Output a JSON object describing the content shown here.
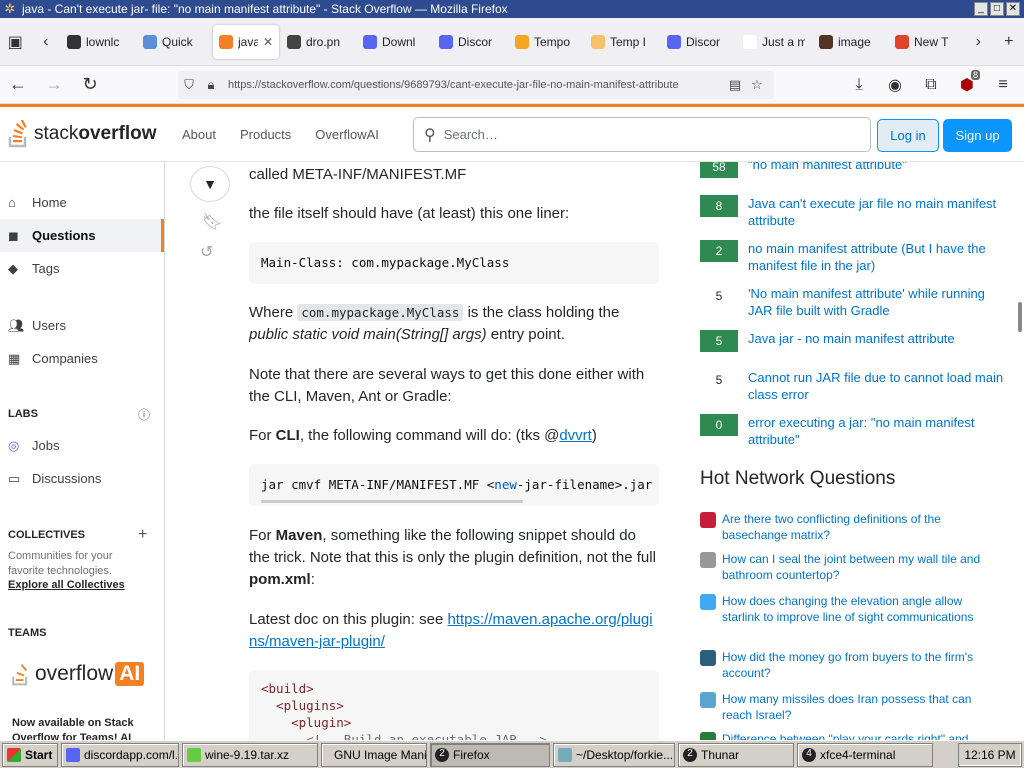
{
  "window": {
    "title": "java - Can't execute jar- file: \"no main manifest attribute\" - Stack Overflow — Mozilla Firefox"
  },
  "tabs": [
    {
      "label": "lownlc",
      "color": "#333"
    },
    {
      "label": "Quick",
      "color": "#5b8fd9"
    },
    {
      "label": "java",
      "color": "#f48024",
      "active": true
    },
    {
      "label": "dro.pn",
      "color": "#444"
    },
    {
      "label": "Downl",
      "color": "#5865f2"
    },
    {
      "label": "Discor",
      "color": "#5865f2"
    },
    {
      "label": "Tempo",
      "color": "#f5a623"
    },
    {
      "label": "Temp I",
      "color": "#f5c26b"
    },
    {
      "label": "Discor",
      "color": "#5865f2"
    },
    {
      "label": "Just a mom",
      "color": "#ffffff"
    },
    {
      "label": "image",
      "color": "#553322"
    },
    {
      "label": "New T",
      "color": "#e0452c"
    }
  ],
  "urlbar": {
    "url": "https://stackoverflow.com/questions/9689793/cant-execute-jar-file-no-main-manifest-attribute"
  },
  "toolbar": {
    "addon_badge": "8"
  },
  "so_header": {
    "logo_plain": "stack",
    "logo_bold": "overflow",
    "nav": [
      "About",
      "Products",
      "OverflowAI"
    ],
    "search_placeholder": "Search…",
    "login": "Log in",
    "signup": "Sign up"
  },
  "sidebar": {
    "home": "Home",
    "questions": "Questions",
    "tags": "Tags",
    "users": "Users",
    "companies": "Companies",
    "labs": "LABS",
    "jobs": "Jobs",
    "discussions": "Discussions",
    "collectives": "COLLECTIVES",
    "collectives_text": "Communities for your favorite technologies.",
    "explore": "Explore all Collectives",
    "teams": "TEAMS",
    "oai_word": "overflow",
    "oai_ai": "AI",
    "teams_text": "Now available on Stack Overflow for Teams! AI"
  },
  "answer": {
    "p1": "called META-INF/MANIFEST.MF",
    "p2": "the file itself should have (at least) this one liner:",
    "code1": "Main-Class: com.mypackage.MyClass",
    "p3_a": "Where ",
    "p3_code": "com.mypackage.MyClass",
    "p3_b": " is the class holding the",
    "p3_em": "public static void main(String[] args)",
    "p3_c": " entry point.",
    "p4": "Note that there are several ways to get this done either with the CLI, Maven, Ant or Gradle:",
    "p5_a": "For ",
    "p5_b": "CLI",
    "p5_c": ", the following command will do: (tks @",
    "p5_link": "dvvrt",
    "p5_d": ")",
    "code2_a": "jar cmvf META-INF/MANIFEST.MF <",
    "code2_kw": "new",
    "code2_b": "-jar-filename>.jar",
    "p6_a": "For ",
    "p6_b": "Maven",
    "p6_c": ", something like the following snippet should do the trick. Note that this is only the plugin definition, not the full ",
    "p6_d": "pom.xml",
    "p6_e": ":",
    "p7_a": "Latest doc on this plugin: see ",
    "p7_link": "https://maven.apache.org/plugins/maven-jar-plugin/",
    "code3_l1": "<build>",
    "code3_l2": "  <plugins>",
    "code3_l3": "    <plugin>",
    "code3_l4": "      <!-- Build an executable JAR -->"
  },
  "linked": [
    {
      "score": "58",
      "title": "\"no main manifest attribute\"",
      "green": true
    },
    {
      "score": "8",
      "title": "Java can't execute jar file no main manifest attribute",
      "green": true
    },
    {
      "score": "2",
      "title": "no main manifest attribute (But I have the manifest file in the jar)",
      "green": true
    },
    {
      "score": "5",
      "title": "'No main manifest attribute' while running JAR file built with Gradle",
      "green": false
    },
    {
      "score": "5",
      "title": "Java jar - no main manifest attribute",
      "green": true
    },
    {
      "score": "5",
      "title": "Cannot run JAR file due to cannot load main class error",
      "green": false
    },
    {
      "score": "0",
      "title": "error executing a jar: \"no main manifest attribute\"",
      "green": true
    }
  ],
  "hnq": {
    "heading": "Hot Network Questions",
    "items": [
      {
        "title": "Are there two conflicting definitions of the basechange matrix?",
        "color": "#c41e3a"
      },
      {
        "title": "How can I seal the joint between my wall tile and bathroom countertop?",
        "color": "#999999"
      },
      {
        "title": "How does changing the elevation angle allow starlink to improve line of sight communications",
        "color": "#3fa9f5"
      },
      {
        "title": "How did the money go from buyers to the firm's account?",
        "color": "#2c5f7c"
      },
      {
        "title": "How many missiles does Iran possess that can reach Israel?",
        "color": "#5ba4cf"
      },
      {
        "title": "Difference between \"play your cards right\" and",
        "color": "#2a7a3b"
      }
    ]
  },
  "taskbar": {
    "start": "Start",
    "items": [
      "discordapp.com/l...",
      "wine-9.19.tar.xz",
      "GNU Image Mani...",
      "Firefox",
      "~/Desktop/forkie...",
      "Thunar",
      "xfce4-terminal"
    ],
    "firefox_count": "2",
    "thunar_count": "2",
    "terminal_count": "4",
    "clock": "12:16 PM"
  }
}
